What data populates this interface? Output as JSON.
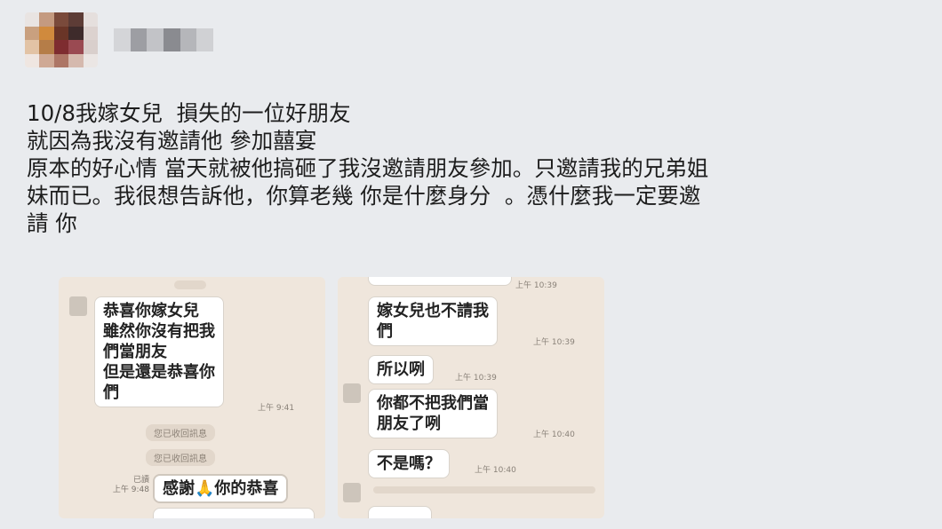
{
  "post": {
    "lines": [
      "10/8我嫁女兒  損失的一位好朋友",
      "就因為我沒有邀請他 參加囍宴",
      "原本的好心情 當天就被他搞砸了我沒邀請朋友參加。只邀請我的兄弟姐",
      "妹而已。我很想告訴他，你算老幾 你是什麼身分  。憑什麼我一定要邀",
      "請 你"
    ]
  },
  "colors": {
    "background": "#e9ebee",
    "chat_background": "#efe6dc",
    "bubble": "#ffffff",
    "text": "#1d1d1d"
  },
  "chat_left": {
    "incoming_bubble": "恭喜你嫁女兒\n雖然你沒有把我\n們當朋友\n但是還是恭喜你\n們",
    "incoming_time": "上午 9:41",
    "system_msg_1": "您已收回訊息",
    "system_msg_2": "您已收回訊息",
    "read_label": "已讀",
    "outgoing_time": "上午 9:48",
    "outgoing_bubble": "感謝🙏你的恭喜"
  },
  "chat_right": {
    "top_time": "上午 10:39",
    "bubble_1": "嫁女兒也不請我\n們",
    "bubble_1_time": "上午 10:39",
    "bubble_2": "所以咧",
    "bubble_2_time": "上午 10:39",
    "bubble_3": "你都不把我們當\n朋友了咧",
    "bubble_3_time": "上午 10:40",
    "bubble_4": "不是嗎？",
    "bubble_4_time": "上午 10:40"
  }
}
